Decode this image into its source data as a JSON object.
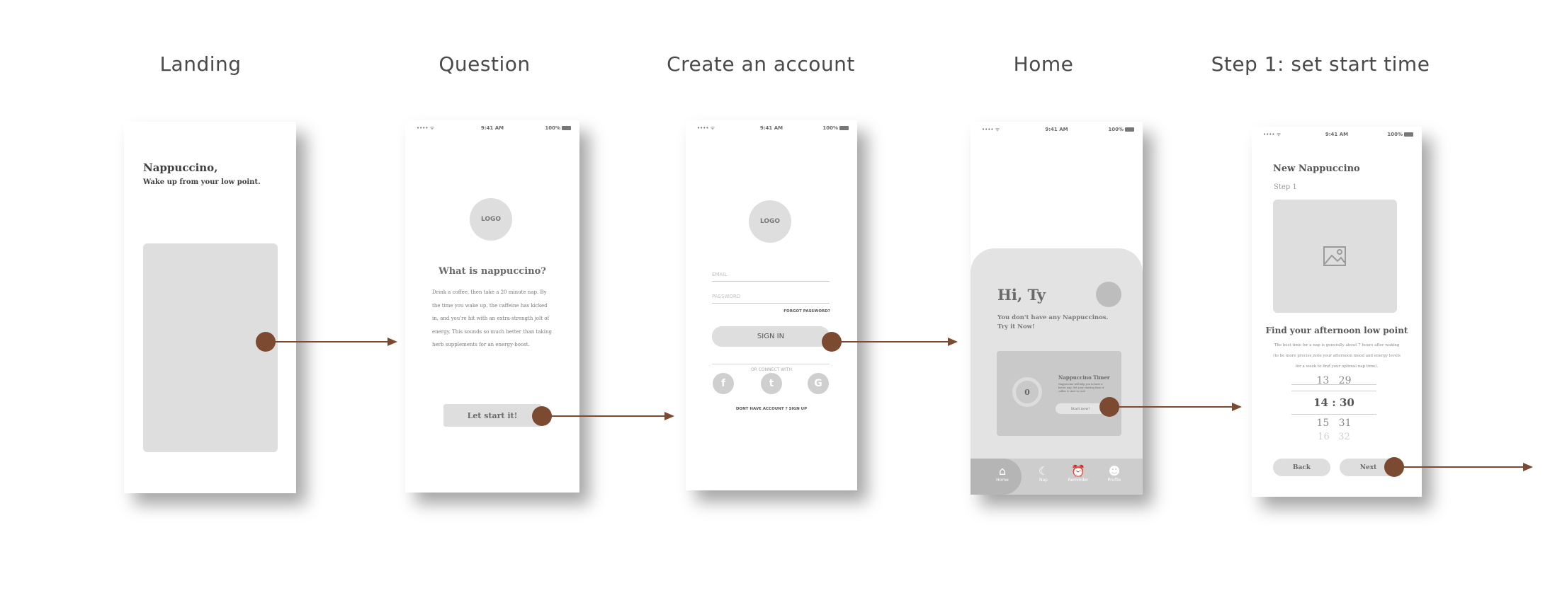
{
  "titles": [
    "Landing",
    "Question",
    "Create an account",
    "Home",
    "Step 1: set start time"
  ],
  "status": {
    "signal": "•••• ᯤ",
    "time": "9:41 AM",
    "battery": "100%"
  },
  "landing": {
    "app_name": "Nappuccino,",
    "tagline": "Wake up from your low point."
  },
  "question": {
    "logo": "LOGO",
    "heading": "What is nappuccino?",
    "body_lines": [
      "Drink a coffee, then take a 20 minute nap. By",
      "the time you wake up, the caffeine has kicked",
      "in, and you're hit with an extra-strength jolt of",
      "energy. This sounds so much better than taking",
      "herb supplements for an energy-boost."
    ],
    "cta": "Let start it!"
  },
  "account": {
    "logo": "LOGO",
    "email_placeholder": "EMAIL",
    "password_placeholder": "PASSWORD",
    "forgot": "FORGOT PASSWORD?",
    "sign_in": "SIGN IN",
    "or_connect": "OR CONNECT WITH",
    "social": [
      "f",
      "t",
      "G"
    ],
    "signup_prompt": "DONT HAVE ACCOUNT ?",
    "signup_link": "SIGN UP"
  },
  "home": {
    "greeting": "Hi, Ty",
    "message_line1": "You don't have any Nappuccinos.",
    "message_line2": "Try it Now!",
    "card_title": "Nappuccino Timer",
    "card_desc": "Nappuccino will help you to have a better nap. Set your starting time of coffee & start to rest!",
    "timer_value": "0",
    "start_button": "Start now!",
    "tabs": [
      "Home",
      "Nap",
      "Reminder",
      "Profile"
    ]
  },
  "step1": {
    "title": "New Nappuccino",
    "step": "Step 1",
    "heading": "Find your afternoon low point",
    "desc_lines": [
      "The best time for a nap is generally about 7 hours after waking",
      "(to be more precise,note your afternoon mood and energy levels",
      "for a week to find your optimal nap time)."
    ],
    "wheel_rows": [
      {
        "h": "13",
        "m": "29"
      },
      {
        "h": "14",
        "m": "30",
        "selected": true
      },
      {
        "h": "15",
        "m": "31"
      },
      {
        "h": "16",
        "m": "32"
      }
    ],
    "back": "Back",
    "next": "Next"
  },
  "colors": {
    "accent": "#7b4a30",
    "placeholder": "#dedede",
    "text": "#4a4a4a"
  },
  "icons": [
    "home-icon",
    "moon-icon",
    "alarm-icon",
    "person-icon",
    "image-icon",
    "facebook-icon",
    "twitter-icon",
    "google-icon"
  ]
}
